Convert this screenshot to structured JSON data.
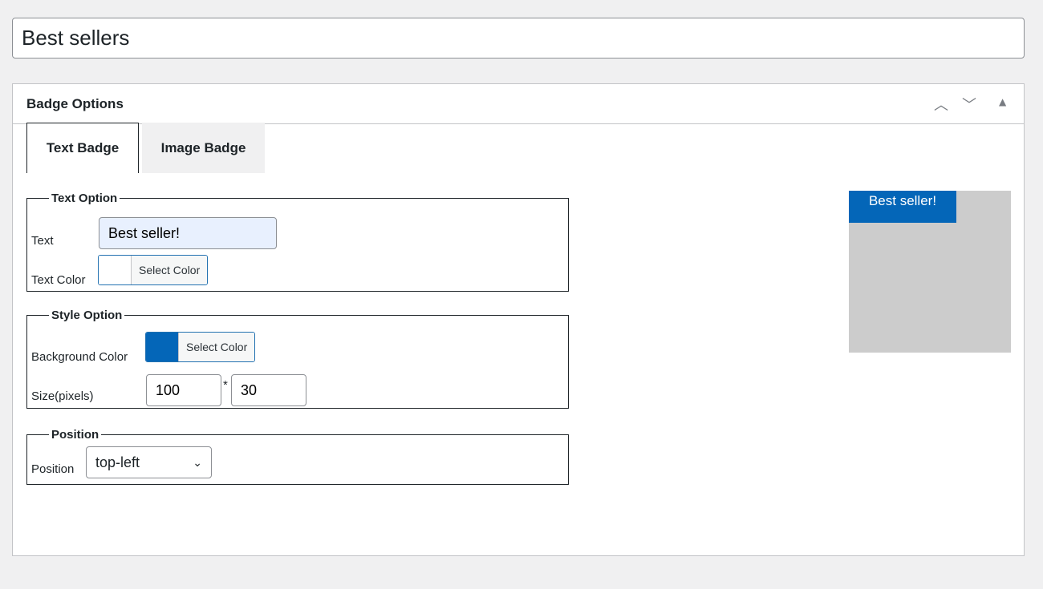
{
  "post_title": "Best sellers",
  "panel": {
    "title": "Badge Options",
    "controls": {
      "move_up": "^",
      "move_down": "v",
      "toggle": "▲"
    }
  },
  "tabs": [
    {
      "label": "Text Badge",
      "active": true
    },
    {
      "label": "Image Badge",
      "active": false
    }
  ],
  "text_option": {
    "legend": "Text Option",
    "text_label": "Text",
    "text_value": "Best seller!",
    "color_label": "Text Color",
    "color_button": "Select Color",
    "color_value": "#ffffff"
  },
  "style_option": {
    "legend": "Style Option",
    "bg_label": "Background Color",
    "bg_button": "Select Color",
    "bg_value": "#0466b8",
    "size_label": "Size(pixels)",
    "width": "100",
    "separator": "*",
    "height": "30"
  },
  "position": {
    "legend": "Position",
    "label": "Position",
    "selected": "top-left"
  },
  "preview": {
    "badge_text": "Best seller!",
    "background": "#cccccc"
  }
}
